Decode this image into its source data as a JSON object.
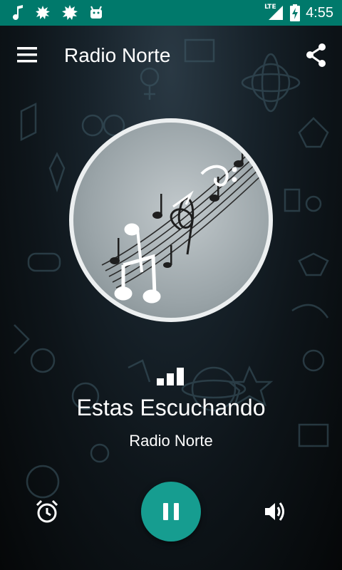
{
  "status_bar": {
    "time": "4:55",
    "network": "LTE",
    "notification_icons": [
      "music-note-icon",
      "splat-icon",
      "splat-icon",
      "android-icon"
    ],
    "right_icons": [
      "signal-icon",
      "battery-charging-icon"
    ],
    "background": "#00796b"
  },
  "app_bar": {
    "title": "Radio Norte",
    "menu_icon": "hamburger-menu-icon",
    "share_icon": "share-icon"
  },
  "player": {
    "now_playing_label": "Estas Escuchando",
    "station_name": "Radio Norte",
    "level_icon": "signal-bars-icon",
    "controls": {
      "alarm_icon": "alarm-clock-icon",
      "play_state_icon": "pause-icon",
      "volume_icon": "volume-up-icon",
      "play_button_color": "#169d90"
    }
  },
  "artwork": {
    "icon": "music-notes-artwork"
  }
}
